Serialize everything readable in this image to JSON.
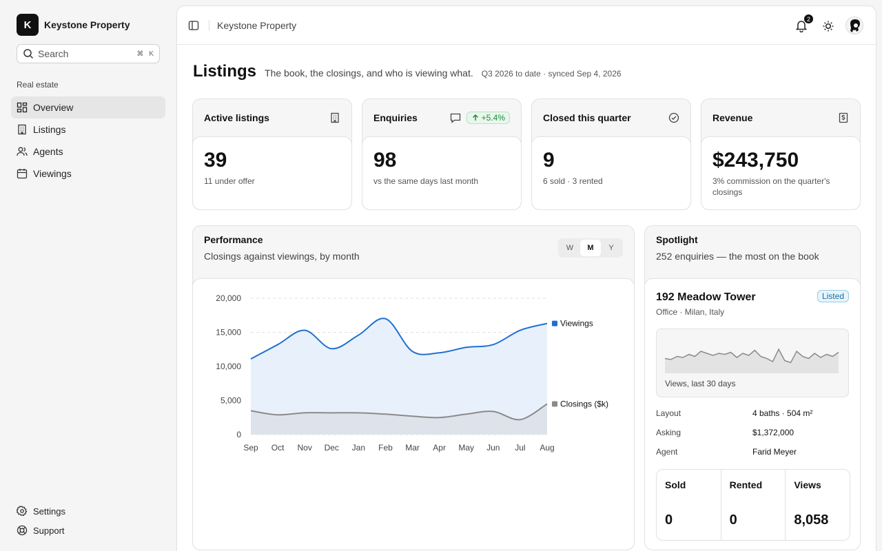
{
  "app": {
    "brand_initial": "K",
    "brand_name": "Keystone Property"
  },
  "search": {
    "placeholder": "Search",
    "shortcut_mod": "⌘",
    "shortcut_key": "K"
  },
  "sidebar": {
    "section_label": "Real estate",
    "items": [
      {
        "label": "Overview",
        "icon": "layout-dashboard-icon",
        "active": true
      },
      {
        "label": "Listings",
        "icon": "building-icon"
      },
      {
        "label": "Agents",
        "icon": "users-icon"
      },
      {
        "label": "Viewings",
        "icon": "calendar-icon"
      }
    ],
    "bottom": [
      {
        "label": "Settings",
        "icon": "gear-icon"
      },
      {
        "label": "Support",
        "icon": "life-buoy-icon"
      }
    ]
  },
  "topbar": {
    "breadcrumb": "Keystone Property",
    "notification_count": "2"
  },
  "page": {
    "title": "Listings",
    "subtitle": "The book, the closings, and who is viewing what.",
    "meta": "Q3 2026 to date · synced Sep 4, 2026"
  },
  "kpis": [
    {
      "title": "Active listings",
      "value": "39",
      "note": "11 under offer",
      "icon": "building-icon"
    },
    {
      "title": "Enquiries",
      "value": "98",
      "note": "vs the same days last month",
      "icon": "message-icon",
      "trend": "+5.4%"
    },
    {
      "title": "Closed this quarter",
      "value": "9",
      "note": "6 sold · 3 rented",
      "icon": "check-circle-icon"
    },
    {
      "title": "Revenue",
      "value": "$243,750",
      "note": "3% commission on the quarter's closings",
      "icon": "receipt-dollar-icon"
    }
  ],
  "performance": {
    "title": "Performance",
    "subtitle": "Closings against viewings, by month",
    "segments": [
      "W",
      "M",
      "Y"
    ],
    "active_segment": "M"
  },
  "chart_data": {
    "type": "area",
    "x": [
      "Sep",
      "Oct",
      "Nov",
      "Dec",
      "Jan",
      "Feb",
      "Mar",
      "Apr",
      "May",
      "Jun",
      "Jul",
      "Aug"
    ],
    "ylim": [
      0,
      20000
    ],
    "yticks": [
      "20,000",
      "15,000",
      "10,000",
      "5,000",
      "0"
    ],
    "grid": true,
    "legend": "end-of-line labels",
    "series": [
      {
        "name": "Viewings",
        "color": "#1f6fd1",
        "values": [
          11100,
          13200,
          15300,
          12600,
          14600,
          17000,
          12200,
          12000,
          12800,
          13200,
          15300,
          16300
        ]
      },
      {
        "name": "Closings ($k)",
        "color": "#8a8a8a",
        "values": [
          3500,
          2900,
          3200,
          3200,
          3200,
          3000,
          2700,
          2500,
          3000,
          3400,
          2200,
          4500
        ]
      }
    ]
  },
  "spotlight": {
    "title": "Spotlight",
    "subtitle": "252 enquiries — the most on the book",
    "property": "192 Meadow Tower",
    "type": "Office · Milan, Italy",
    "status": "Listed",
    "spark_caption": "Views, last 30 days",
    "spark_values": [
      0.45,
      0.4,
      0.55,
      0.5,
      0.65,
      0.55,
      0.8,
      0.7,
      0.6,
      0.7,
      0.65,
      0.75,
      0.5,
      0.7,
      0.6,
      0.85,
      0.55,
      0.45,
      0.3,
      0.9,
      0.35,
      0.25,
      0.8,
      0.55,
      0.45,
      0.7,
      0.5,
      0.65,
      0.55,
      0.75
    ],
    "details": [
      {
        "k": "Layout",
        "v": "4 baths · 504 m²"
      },
      {
        "k": "Asking",
        "v": "$1,372,000"
      },
      {
        "k": "Agent",
        "v": "Farid Meyer"
      }
    ],
    "stats": [
      {
        "label": "Sold",
        "value": "0"
      },
      {
        "label": "Rented",
        "value": "0"
      },
      {
        "label": "Views",
        "value": "8,058"
      }
    ]
  },
  "colors": {
    "accent": "#1f6fd1",
    "closings": "#8a8a8a",
    "trend_green": "#1f8a3d"
  }
}
